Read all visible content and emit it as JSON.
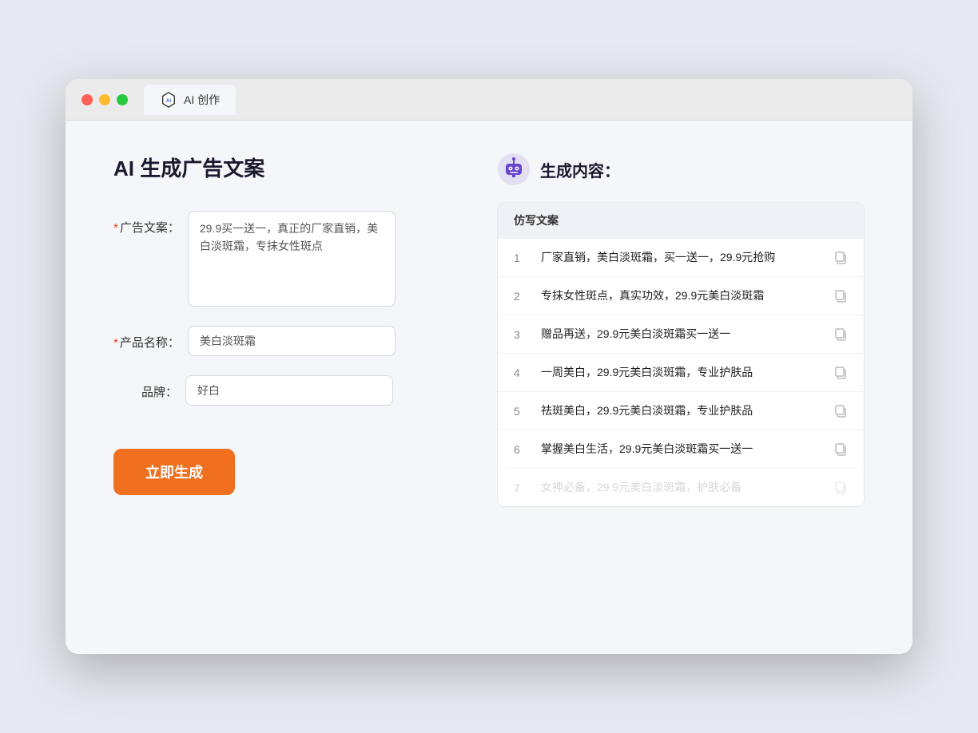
{
  "titlebar": {
    "tab_label": "AI 创作"
  },
  "left_panel": {
    "page_title": "AI 生成广告文案",
    "fields": [
      {
        "label": "广告文案：",
        "required": true,
        "type": "textarea",
        "value": "29.9买一送一，真正的厂家直销，美白淡斑霜，专抹女性斑点",
        "placeholder": ""
      },
      {
        "label": "产品名称：",
        "required": true,
        "type": "input",
        "value": "美白淡斑霜",
        "placeholder": ""
      },
      {
        "label": "品牌：",
        "required": false,
        "type": "input",
        "value": "好白",
        "placeholder": ""
      }
    ],
    "button_label": "立即生成"
  },
  "right_panel": {
    "title": "生成内容：",
    "table_header": "仿写文案",
    "rows": [
      {
        "number": "1",
        "text": "厂家直销，美白淡斑霜，买一送一，29.9元抢购"
      },
      {
        "number": "2",
        "text": "专抹女性斑点，真实功效，29.9元美白淡斑霜"
      },
      {
        "number": "3",
        "text": "赠品再送，29.9元美白淡斑霜买一送一"
      },
      {
        "number": "4",
        "text": "一周美白，29.9元美白淡斑霜，专业护肤品"
      },
      {
        "number": "5",
        "text": "祛斑美白，29.9元美白淡斑霜，专业护肤品"
      },
      {
        "number": "6",
        "text": "掌握美白生活，29.9元美白淡斑霜买一送一"
      },
      {
        "number": "7",
        "text": "女神必备，29.9元美白淡斑霜，护肤必备"
      }
    ]
  }
}
